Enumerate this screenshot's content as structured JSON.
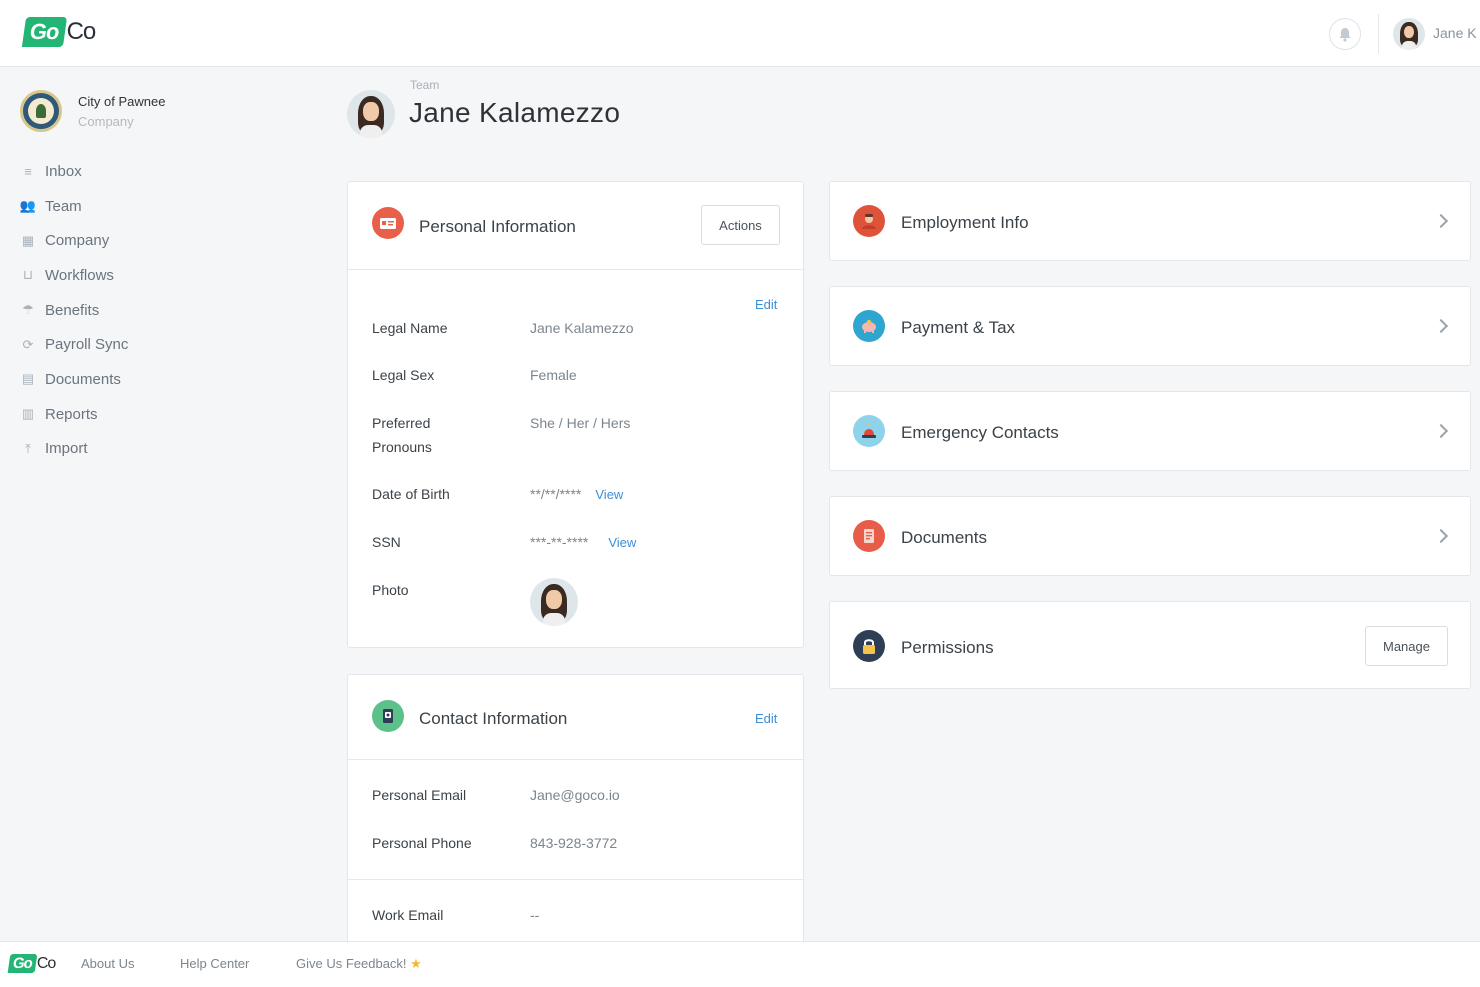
{
  "brand": {
    "go": "Go",
    "co": "Co"
  },
  "topbar": {
    "user_name": "Jane K",
    "bell_icon": "bell-icon"
  },
  "sidebar": {
    "company_name": "City of Pawnee",
    "company_sub": "Company",
    "items": [
      {
        "label": "Inbox",
        "icon": "≡"
      },
      {
        "label": "Team",
        "icon": "👥"
      },
      {
        "label": "Company",
        "icon": "▦"
      },
      {
        "label": "Workflows",
        "icon": "⊔"
      },
      {
        "label": "Benefits",
        "icon": "☂"
      },
      {
        "label": "Payroll Sync",
        "icon": "⟳"
      },
      {
        "label": "Documents",
        "icon": "▤"
      },
      {
        "label": "Reports",
        "icon": "▥"
      },
      {
        "label": "Import",
        "icon": "⤒"
      }
    ]
  },
  "header": {
    "breadcrumb": "Team",
    "title": "Jane Kalamezzo"
  },
  "personal": {
    "title": "Personal Information",
    "actions_label": "Actions",
    "edit_label": "Edit",
    "rows": {
      "legal_name": {
        "label": "Legal Name",
        "value": "Jane Kalamezzo"
      },
      "legal_sex": {
        "label": "Legal Sex",
        "value": "Female"
      },
      "pronouns": {
        "label_1": "Preferred",
        "label_2": "Pronouns",
        "value": "She / Her / Hers"
      },
      "dob": {
        "label": "Date of Birth",
        "value": "**/**/****",
        "view": "View"
      },
      "ssn": {
        "label": "SSN",
        "value": "***-**-****",
        "view": "View"
      },
      "photo": {
        "label": "Photo"
      }
    }
  },
  "contact": {
    "title": "Contact Information",
    "edit_label": "Edit",
    "rows": {
      "personal_email": {
        "label": "Personal Email",
        "value": "Jane@goco.io"
      },
      "personal_phone": {
        "label": "Personal Phone",
        "value": "843-928-3772"
      },
      "work_email": {
        "label": "Work Email",
        "value": "--"
      }
    }
  },
  "sections": [
    {
      "title": "Employment Info",
      "color": "#e0533b"
    },
    {
      "title": "Payment & Tax",
      "color": "#2ea6cf"
    },
    {
      "title": "Emergency Contacts",
      "color": "#8fd3ea"
    },
    {
      "title": "Documents",
      "color": "#e85c4a"
    }
  ],
  "permissions": {
    "title": "Permissions",
    "manage_label": "Manage",
    "color": "#2e3e55"
  },
  "footer": {
    "about": "About Us",
    "help": "Help Center",
    "feedback": "Give Us Feedback!",
    "star": "★"
  }
}
